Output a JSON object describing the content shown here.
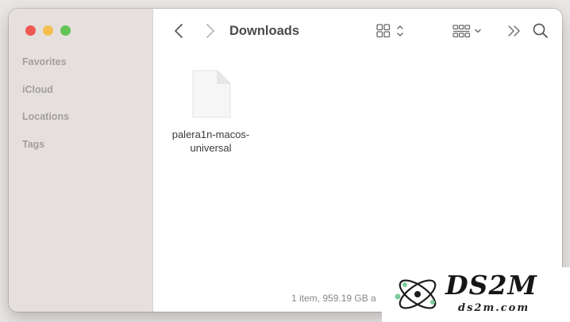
{
  "sidebar": {
    "sections": [
      "Favorites",
      "iCloud",
      "Locations",
      "Tags"
    ]
  },
  "toolbar": {
    "title": "Downloads",
    "icons": [
      "back-chevron-icon",
      "forward-chevron-icon",
      "icon-grid-view-icon",
      "group-view-icon",
      "more-toolbar-icon",
      "search-icon"
    ]
  },
  "files": [
    {
      "name": "palera1n-macos-universal",
      "icon": "document-icon"
    }
  ],
  "status_bar": {
    "text": "1 item, 959.19 GB a"
  },
  "watermark": {
    "title": "DS2M",
    "url": "ds2m.com"
  },
  "colors": {
    "close": "#ee5a52",
    "minimize": "#f4bf4f",
    "maximize": "#61c454",
    "sidebar_bg": "#e5e0de"
  }
}
